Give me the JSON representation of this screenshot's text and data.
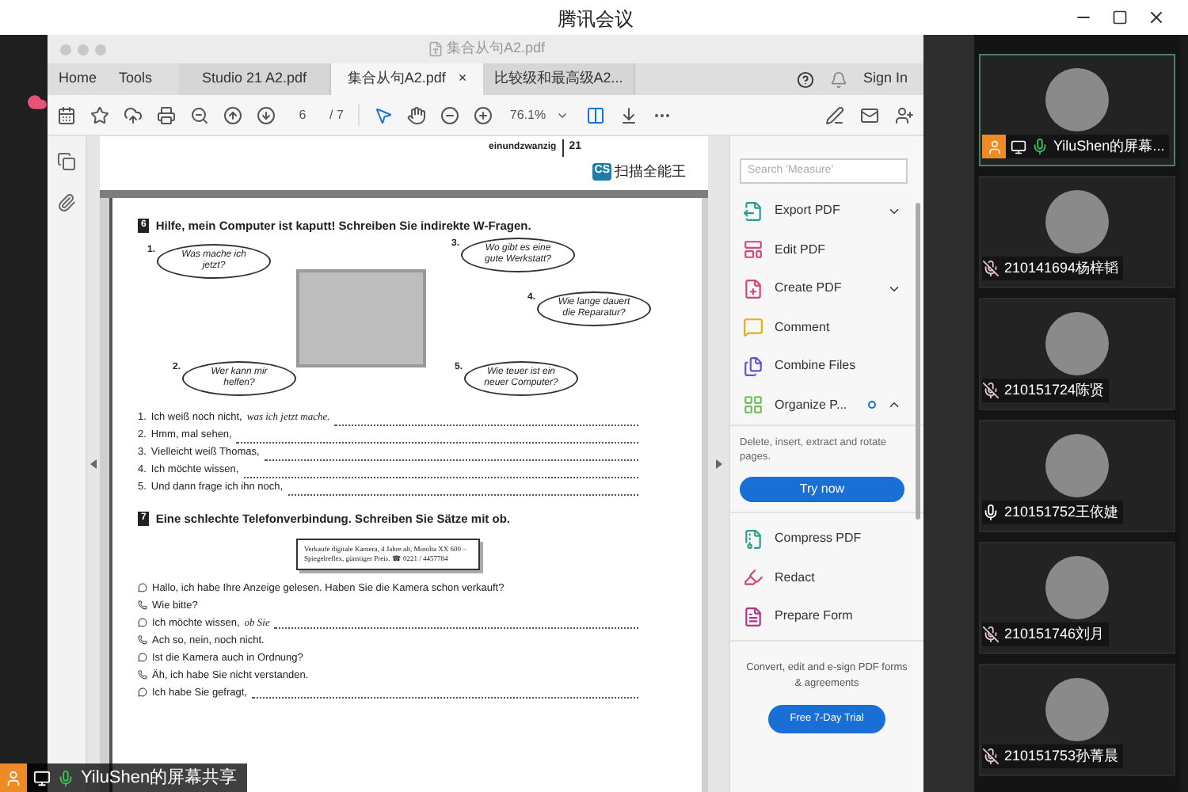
{
  "app_title": "腾讯会议",
  "acrobat": {
    "window_title": "集合从句A2.pdf",
    "nav": [
      "Home",
      "Tools"
    ],
    "tabs": [
      {
        "label": "Studio 21 A2.pdf",
        "selected": false
      },
      {
        "label": "集合从句A2.pdf",
        "selected": true,
        "close": "×"
      },
      {
        "label": "比较级和最高级A2...",
        "selected": false
      }
    ],
    "sign_in": "Sign In",
    "page": "6",
    "page_total": "/ 7",
    "zoom": "76.1%"
  },
  "document": {
    "header_word": "einundzwanzig",
    "header_page": "21",
    "scanner_badge": "CS",
    "scanner_name": "扫描全能王",
    "exercise_6": {
      "number": "6",
      "title": "Hilfe, mein Computer ist kaputt! Schreiben Sie indirekte W-Fragen.",
      "bubbles": [
        {
          "number": "1.",
          "text": "Was mache ich jetzt?"
        },
        {
          "number": "2.",
          "text": "Wer kann mir helfen?"
        },
        {
          "number": "3.",
          "text": "Wo gibt es eine gute Werkstatt?"
        },
        {
          "number": "4.",
          "text": "Wie lange dauert die Reparatur?"
        },
        {
          "number": "5.",
          "text": "Wie teuer ist ein neuer Computer?"
        }
      ],
      "lines": [
        {
          "number": "1.",
          "text": "Ich weiß noch nicht,",
          "answer": "was ich jetzt mache."
        },
        {
          "number": "2.",
          "text": "Hmm, mal sehen,"
        },
        {
          "number": "3.",
          "text": "Vielleicht weiß Thomas,"
        },
        {
          "number": "4.",
          "text": "Ich möchte wissen,"
        },
        {
          "number": "5.",
          "text": "Und dann frage ich ihn noch,"
        }
      ]
    },
    "exercise_7": {
      "number": "7",
      "title": "Eine schlechte Telefonverbindung. Schreiben Sie Sätze mit ob.",
      "ad": "Verkaufe digitale Kamera, 4 Jahre alt, Minolta XX 600 – Spiegelreflex, günstiger Preis. ☎ 0221 / 4457784",
      "lines": [
        {
          "kind": "caller",
          "text": "Hallo, ich habe Ihre Anzeige gelesen. Haben Sie die Kamera schon verkauft?"
        },
        {
          "kind": "seller",
          "text": "Wie bitte?"
        },
        {
          "kind": "caller",
          "text": "Ich möchte wissen,",
          "answer": "ob Sie",
          "blank": true
        },
        {
          "kind": "seller",
          "text": "Ach so, nein, noch nicht."
        },
        {
          "kind": "caller",
          "text": "Ist die Kamera auch in Ordnung?"
        },
        {
          "kind": "seller",
          "text": "Äh, ich habe Sie nicht verstanden."
        },
        {
          "kind": "caller",
          "text": "Ich habe Sie gefragt,",
          "blank": true
        }
      ]
    }
  },
  "tools_panel": {
    "search": {
      "placeholder": "Search 'Measure'"
    },
    "tools": [
      {
        "kind": "export",
        "label": "Export PDF",
        "expanded": false,
        "has_toggle": true
      },
      {
        "kind": "edit",
        "label": "Edit PDF",
        "has_toggle": false
      },
      {
        "kind": "create",
        "label": "Create PDF",
        "expanded": false,
        "has_toggle": true
      },
      {
        "kind": "comment",
        "label": "Comment",
        "has_toggle": false
      },
      {
        "kind": "combine",
        "label": "Combine Files",
        "has_toggle": false
      },
      {
        "kind": "organize",
        "label": "Organize P...",
        "expanded": true,
        "has_toggle": true,
        "badge": true,
        "description": "Delete, insert, extract and rotate pages.",
        "button": "Try now"
      },
      {
        "kind": "compress",
        "label": "Compress PDF",
        "has_toggle": false
      },
      {
        "kind": "redact",
        "label": "Redact",
        "has_toggle": false
      },
      {
        "kind": "form",
        "label": "Prepare Form",
        "has_toggle": false
      }
    ],
    "promo": "Convert, edit and e-sign PDF forms & agreements",
    "trial_button": "Free 7-Day Trial"
  },
  "participants": [
    {
      "name": "YiluShen的屏幕...",
      "muted": false,
      "speaking": true,
      "selected": true,
      "host": true
    },
    {
      "name": "210141694杨梓韬",
      "muted": true,
      "selected": false,
      "host": false
    },
    {
      "name": "210151724陈贤",
      "muted": true,
      "selected": false,
      "host": false
    },
    {
      "name": "210151752王依婕",
      "muted": false,
      "speaking": false,
      "selected": false,
      "host": false
    },
    {
      "name": "210151746刘月",
      "muted": true,
      "selected": false,
      "host": false
    },
    {
      "name": "210151753孙菁晨",
      "muted": true,
      "selected": false,
      "host": false
    }
  ],
  "share_banner": {
    "label": "YiluShen的屏幕共享"
  }
}
